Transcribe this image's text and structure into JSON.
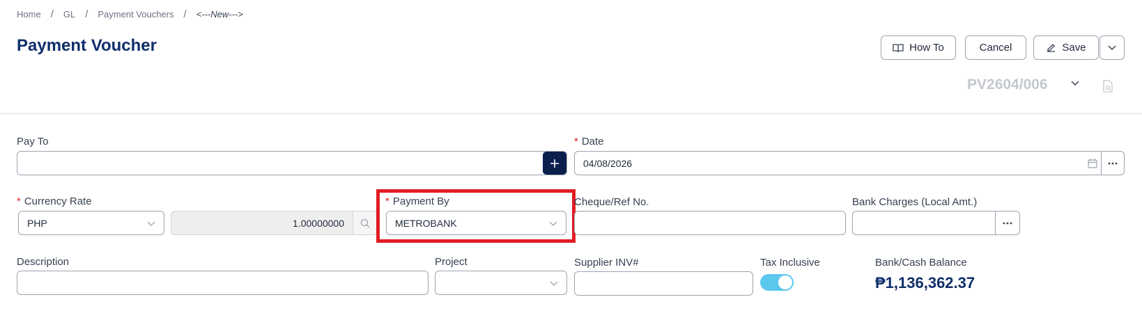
{
  "breadcrumb": {
    "items": [
      "Home",
      "GL",
      "Payment Vouchers"
    ],
    "current": "<---New--->",
    "separator": "/"
  },
  "page_title": "Payment Voucher",
  "toolbar": {
    "how_to_label": "How To",
    "cancel_label": "Cancel",
    "save_label": "Save"
  },
  "document_number": "PV2604/006",
  "form": {
    "pay_to": {
      "label": "Pay To",
      "value": ""
    },
    "date": {
      "label": "Date",
      "value": "04/08/2026",
      "required": true
    },
    "currency_rate": {
      "label": "Currency Rate",
      "currency": "PHP",
      "rate": "1.00000000",
      "required": true
    },
    "payment_by": {
      "label": "Payment By",
      "value": "METROBANK",
      "required": true
    },
    "cheque_ref": {
      "label": "Cheque/Ref No.",
      "value": ""
    },
    "bank_charges": {
      "label": "Bank Charges (Local Amt.)",
      "value": ""
    },
    "description": {
      "label": "Description",
      "value": ""
    },
    "project": {
      "label": "Project",
      "value": ""
    },
    "supplier_inv": {
      "label": "Supplier INV#",
      "value": ""
    },
    "tax_inclusive": {
      "label": "Tax Inclusive",
      "on": true
    },
    "balance": {
      "label": "Bank/Cash Balance",
      "value": "₱1,136,362.37"
    }
  },
  "colors": {
    "title": "#0f2e6b",
    "required": "#dc2626",
    "highlight": "#e01e24",
    "toggle_on": "#5bc8ee",
    "plus_button": "#0b1f4d"
  },
  "icons": [
    "book-icon",
    "pencil-icon",
    "chevron-down-icon",
    "document-search-icon",
    "plus-icon",
    "calendar-icon",
    "ellipsis-icon",
    "search-icon"
  ]
}
